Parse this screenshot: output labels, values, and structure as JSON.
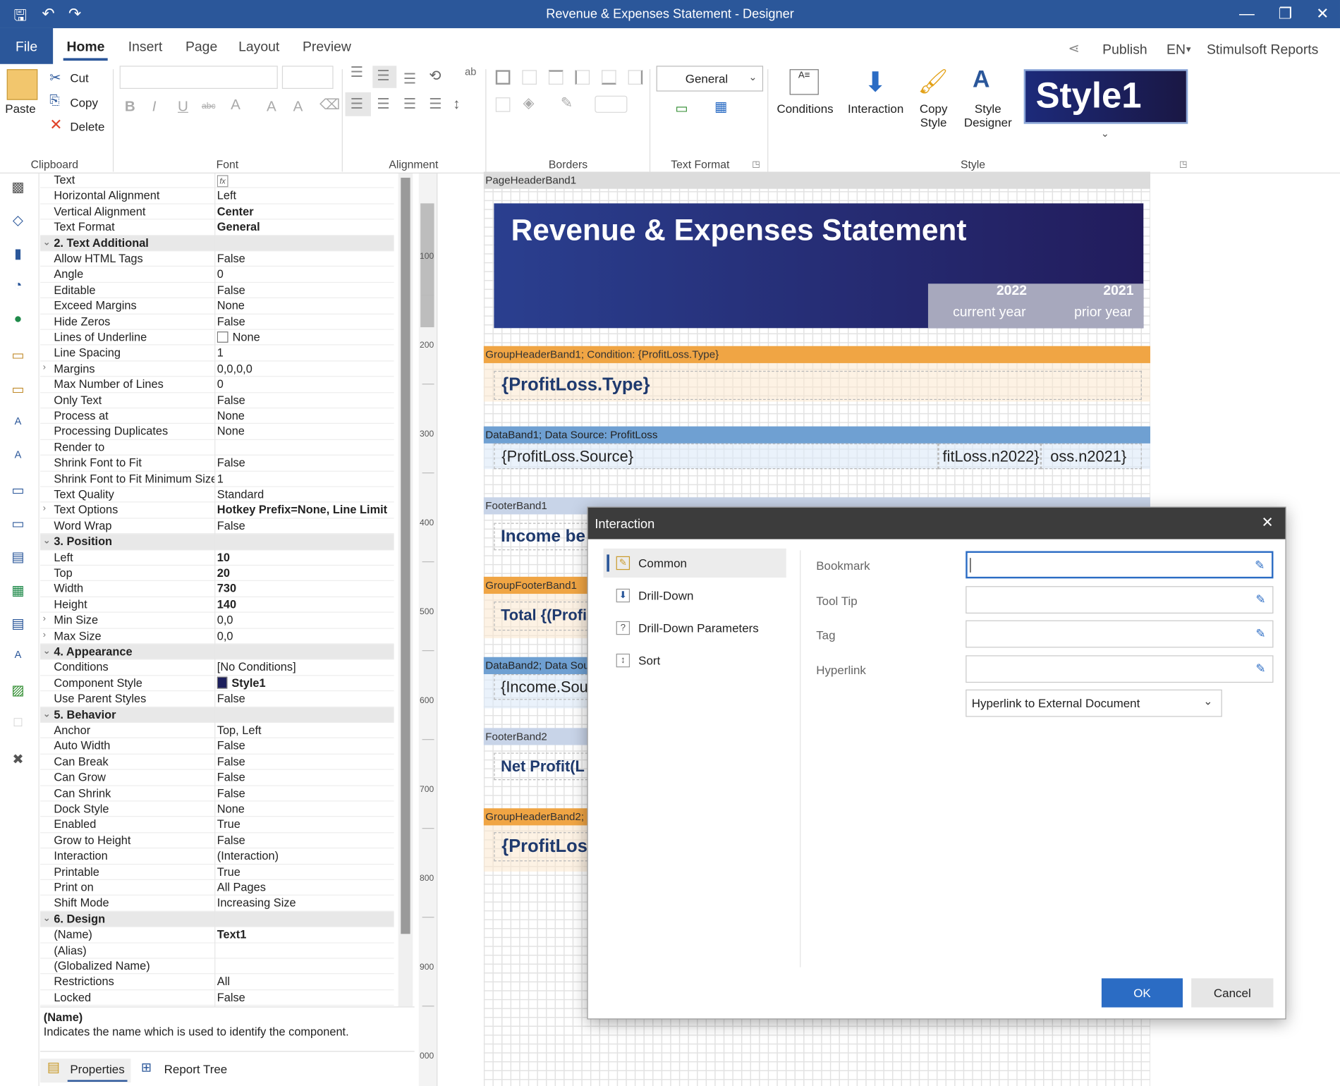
{
  "window": {
    "title": "Revenue & Expenses  Statement  - Designer"
  },
  "tabs": {
    "file": "File",
    "home": "Home",
    "insert": "Insert",
    "page": "Page",
    "layout": "Layout",
    "preview": "Preview"
  },
  "topright": {
    "publish": "Publish",
    "language": "EN",
    "brand": "Stimulsoft Reports"
  },
  "ribbon": {
    "clipboard": {
      "label": "Clipboard",
      "paste": "Paste",
      "cut": "Cut",
      "copy": "Copy",
      "delete": "Delete"
    },
    "font": {
      "label": "Font",
      "bold": "B",
      "italic": "I",
      "underline": "U",
      "strike": "abc"
    },
    "alignment": {
      "label": "Alignment"
    },
    "borders": {
      "label": "Borders"
    },
    "text_format": {
      "label": "Text Format",
      "value": "General"
    },
    "style": {
      "label": "Style",
      "conditions": "Conditions",
      "interaction": "Interaction",
      "copy_style_1": "Copy",
      "copy_style_2": "Style",
      "style_designer_1": "Style",
      "style_designer_2": "Designer",
      "preview": "Style1"
    }
  },
  "properties": [
    {
      "n": "Text",
      "v": "",
      "fx": true
    },
    {
      "n": "Horizontal Alignment",
      "v": "Left"
    },
    {
      "n": "Vertical Alignment",
      "v": "Center",
      "b": true
    },
    {
      "n": "Text Format",
      "v": "General",
      "b": true
    },
    {
      "n": "2. Text  Additional",
      "cat": true
    },
    {
      "n": "Allow HTML Tags",
      "v": "False"
    },
    {
      "n": "Angle",
      "v": "0"
    },
    {
      "n": "Editable",
      "v": "False"
    },
    {
      "n": "Exceed Margins",
      "v": "None"
    },
    {
      "n": "Hide Zeros",
      "v": "False"
    },
    {
      "n": "Lines of Underline",
      "v": "None",
      "box": true
    },
    {
      "n": "Line Spacing",
      "v": "1"
    },
    {
      "n": "Margins",
      "v": "0,0,0,0",
      "exp": true
    },
    {
      "n": "Max Number of Lines",
      "v": "0"
    },
    {
      "n": "Only Text",
      "v": "False"
    },
    {
      "n": "Process at",
      "v": "None"
    },
    {
      "n": "Processing Duplicates",
      "v": "None"
    },
    {
      "n": "Render to",
      "v": ""
    },
    {
      "n": "Shrink Font to Fit",
      "v": "False"
    },
    {
      "n": "Shrink Font to Fit Minimum Size",
      "v": "1"
    },
    {
      "n": "Text Quality",
      "v": "Standard"
    },
    {
      "n": "Text Options",
      "v": "Hotkey Prefix=None, Line Limit",
      "b": true,
      "exp": true
    },
    {
      "n": "Word Wrap",
      "v": "False"
    },
    {
      "n": "3. Position",
      "cat": true
    },
    {
      "n": "Left",
      "v": "10",
      "b": true
    },
    {
      "n": "Top",
      "v": "20",
      "b": true
    },
    {
      "n": "Width",
      "v": "730",
      "b": true
    },
    {
      "n": "Height",
      "v": "140",
      "b": true
    },
    {
      "n": "Min Size",
      "v": "0,0",
      "exp": true
    },
    {
      "n": "Max Size",
      "v": "0,0",
      "exp": true
    },
    {
      "n": "4. Appearance",
      "cat": true
    },
    {
      "n": "Conditions",
      "v": "[No Conditions]"
    },
    {
      "n": "Component Style",
      "v": "Style1",
      "b": true,
      "swatch": true
    },
    {
      "n": "Use Parent Styles",
      "v": "False"
    },
    {
      "n": "5. Behavior",
      "cat": true
    },
    {
      "n": "Anchor",
      "v": "Top, Left"
    },
    {
      "n": "Auto Width",
      "v": "False"
    },
    {
      "n": "Can Break",
      "v": "False"
    },
    {
      "n": "Can Grow",
      "v": "False"
    },
    {
      "n": "Can Shrink",
      "v": "False"
    },
    {
      "n": "Dock Style",
      "v": "None"
    },
    {
      "n": "Enabled",
      "v": "True"
    },
    {
      "n": "Grow to Height",
      "v": "False"
    },
    {
      "n": "Interaction",
      "v": "(Interaction)"
    },
    {
      "n": "Printable",
      "v": "True"
    },
    {
      "n": "Print on",
      "v": "All Pages"
    },
    {
      "n": "Shift Mode",
      "v": "Increasing Size"
    },
    {
      "n": "6. Design",
      "cat": true
    },
    {
      "n": "(Name)",
      "v": "Text1",
      "b": true
    },
    {
      "n": "(Alias)",
      "v": ""
    },
    {
      "n": "(Globalized Name)",
      "v": ""
    },
    {
      "n": "Restrictions",
      "v": "All"
    },
    {
      "n": "Locked",
      "v": "False"
    }
  ],
  "description": {
    "title": "(Name)",
    "text": "Indicates the name which is used to identify the component."
  },
  "bottom_tabs": {
    "properties": "Properties",
    "report_tree": "Report Tree"
  },
  "ruler": [
    "100",
    "200",
    "300",
    "400",
    "500",
    "600",
    "700",
    "800",
    "900",
    "000"
  ],
  "report": {
    "page_header": "PageHeaderBand1",
    "title": "Revenue & Expenses Statement",
    "year_current": "2022",
    "year_current_label": "current year",
    "year_prior": "2021",
    "year_prior_label": "prior year",
    "group_header1": "GroupHeaderBand1; Condition: {ProfitLoss.Type}",
    "group_field1": "{ProfitLoss.Type}",
    "data_band1": "DataBand1; Data Source: ProfitLoss",
    "source_field": "{ProfitLoss.Source}",
    "n2022_field": "fitLoss.n2022}",
    "n2021_field": "oss.n2021}",
    "footer1": "FooterBand1",
    "footer1_field": "Income be",
    "group_footer1": "GroupFooterBand1",
    "group_footer1_field": "Total {(Profi",
    "data_band2": "DataBand2; Data Sou",
    "income_field": "{Income.Sou",
    "footer2": "FooterBand2",
    "footer2_field": "Net Profit(L",
    "group_header2": "GroupHeaderBand2;",
    "group_field2": "{ProfitLos"
  },
  "dialog": {
    "title": "Interaction",
    "nav": [
      "Common",
      "Drill-Down",
      "Drill-Down Parameters",
      "Sort"
    ],
    "labels": {
      "bookmark": "Bookmark",
      "tooltip": "Tool Tip",
      "tag": "Tag",
      "hyperlink": "Hyperlink"
    },
    "hyperlink_type": "Hyperlink to External Document",
    "ok": "OK",
    "cancel": "Cancel"
  },
  "colors": {
    "accent": "#2b579a",
    "title_band": "#242a6b",
    "group_band": "#f0a544",
    "data_band": "#6fa0d2",
    "footer_band": "#c8d4e8"
  }
}
